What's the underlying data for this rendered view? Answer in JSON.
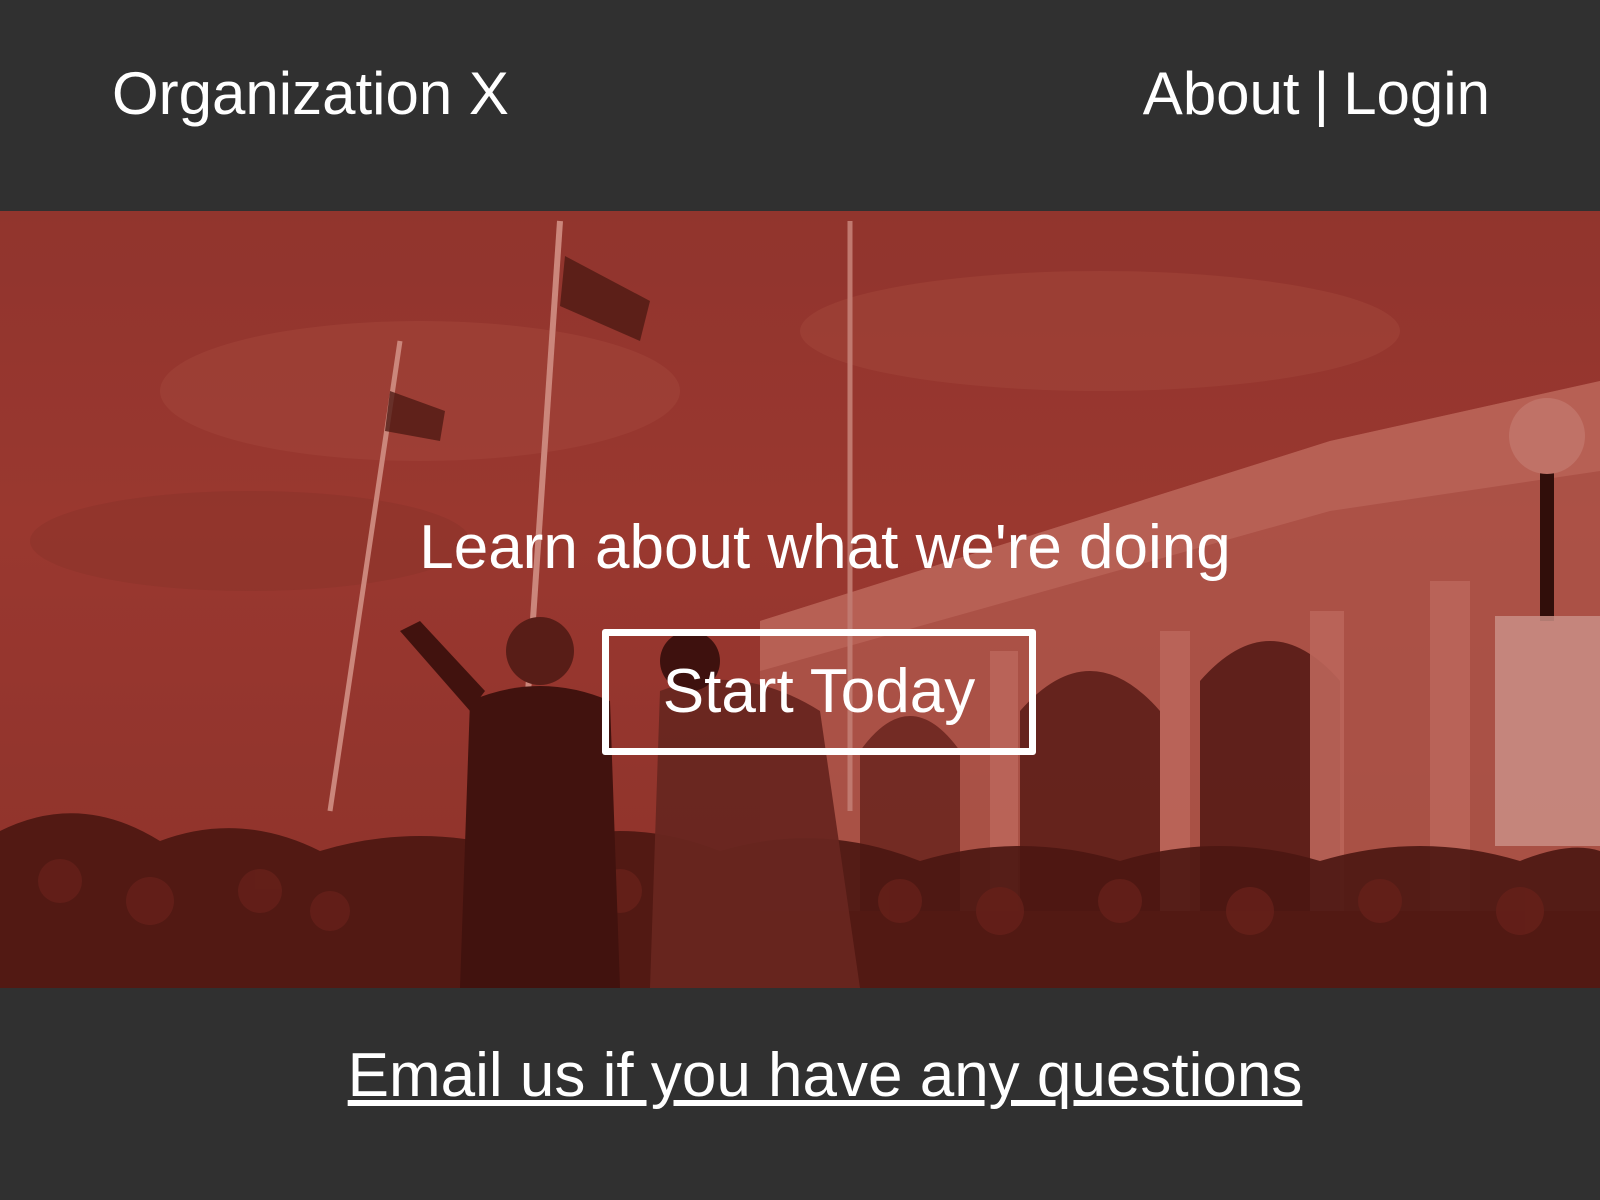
{
  "header": {
    "brand": "Organization X",
    "nav": {
      "about_label": "About",
      "separator": "|",
      "login_label": "Login"
    }
  },
  "hero": {
    "background_image": "rally-photo-red-tint",
    "headline": "Learn about what we're doing",
    "cta_label": "Start Today"
  },
  "footer": {
    "email_link_label": "Email us if you have any questions"
  },
  "colors": {
    "header_bg": "#303030",
    "hero_tint": "#9a3b33",
    "text": "#ffffff"
  }
}
